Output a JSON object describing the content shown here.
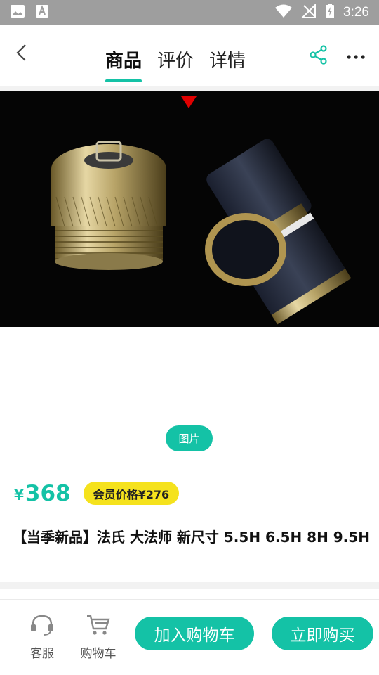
{
  "status_bar": {
    "time": "3:26",
    "left_icons": [
      "image-icon",
      "text-a-icon"
    ],
    "right_icons": [
      "wifi-icon",
      "no-signal-icon",
      "battery-charging-icon"
    ]
  },
  "header": {
    "back_icon": "back-chevron-icon",
    "tabs": [
      {
        "label": "商品",
        "active": true
      },
      {
        "label": "评价",
        "active": false
      },
      {
        "label": "详情",
        "active": false
      }
    ],
    "share_icon": "share-icon",
    "more_icon": "more-icon"
  },
  "gallery": {
    "media_toggle_label": "图片"
  },
  "product": {
    "price_symbol": "¥",
    "price": "368",
    "member_price_label": "会员价格¥276",
    "title": "【当季新品】法氏 大法师 新尺寸 5.5H 6.5H 8H 9.5H"
  },
  "bottom_bar": {
    "service_label": "客服",
    "cart_label": "购物车",
    "add_to_cart_label": "加入购物车",
    "buy_now_label": "立即购买"
  },
  "colors": {
    "accent": "#14c2a6",
    "member_badge": "#f5e21d",
    "status_bar": "#9e9e9e"
  }
}
